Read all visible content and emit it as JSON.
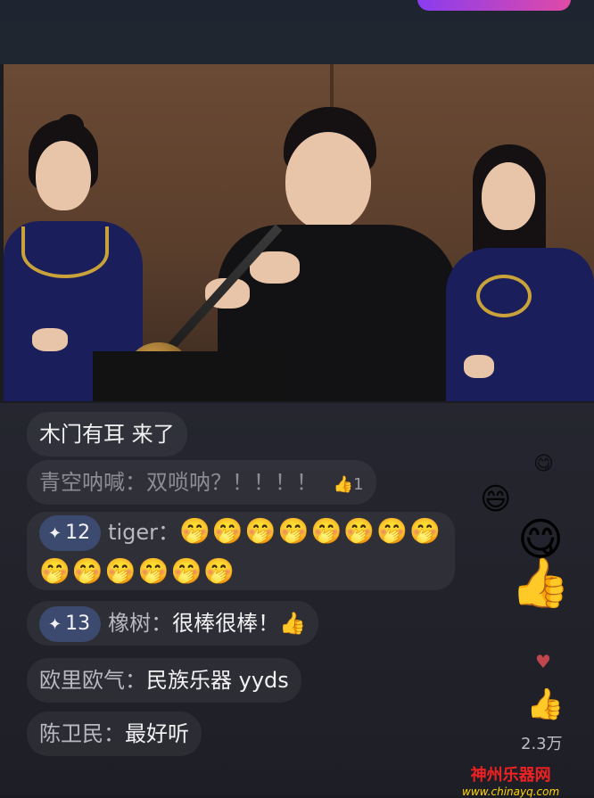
{
  "comments": [
    {
      "text": "木门有耳 来了"
    },
    {
      "user": "青空呐喊：",
      "text": "双唢呐？！！！！",
      "like_count": "1"
    },
    {
      "badge": "12",
      "user": "tiger：",
      "emoji_line1": "🤭🤭🤭🤭🤭🤭🤭🤭",
      "emoji_line2": "🤭🤭🤭🤭🤭🤭"
    },
    {
      "badge": "13",
      "user": "橡树：",
      "text": "很棒很棒！👍"
    },
    {
      "user": "欧里欧气：",
      "text": "民族乐器 yyds"
    },
    {
      "user": "陈卫民：",
      "text": "最好听"
    }
  ],
  "like_total": "2.3万",
  "watermark": {
    "title": "神州乐器网",
    "url": "www.chinayq.com"
  },
  "icons": [
    "sparkle-icon",
    "thumbs-up-icon",
    "heart-icon",
    "emoji-icon"
  ]
}
